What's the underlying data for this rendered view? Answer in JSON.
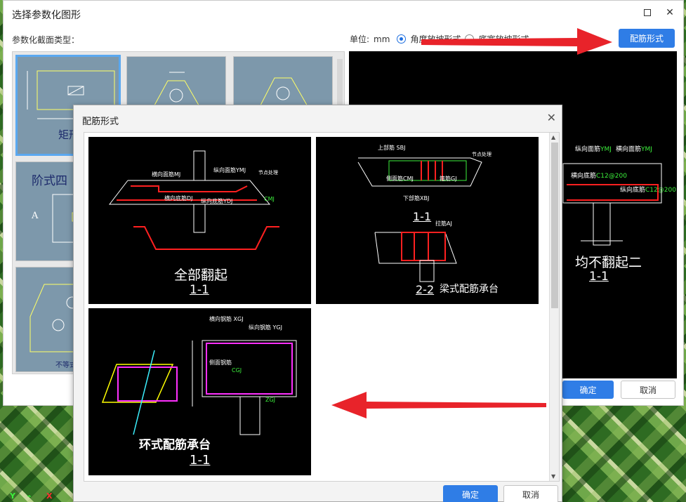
{
  "outer_dialog": {
    "title": "选择参数化图形",
    "section_label": "参数化截面类型：",
    "unit_label": "单位:",
    "unit_value": "mm",
    "radio_angle": "角度放坡形式",
    "radio_width": "底宽放坡形式",
    "rebar_button": "配筋形式",
    "ok": "确定",
    "cancel": "取消",
    "thumb_labels": [
      "矩形",
      "阶式四"
    ],
    "thumb_small": [
      "不等式"
    ],
    "preview_caption": "均不翻起二",
    "preview_section": "1-1"
  },
  "inner_dialog": {
    "title": "配筋形式",
    "ok": "确定",
    "cancel": "取消",
    "cards": [
      {
        "caption": "全部翻起",
        "section": "1-1",
        "labels": [
          "横向面筋MJ",
          "纵向面筋YMJ",
          "横向底筋DJ",
          "纵向底筋YDJ",
          "CMJ",
          "节点处理"
        ]
      },
      {
        "caption": "梁式配筋承台",
        "section1": "1-1",
        "section2": "2-2",
        "labels": [
          "上部筋 SBJ",
          "下部筋XBJ",
          "侧面筋CMJ",
          "节点处理",
          "拉筋AJ",
          "箍筋GJ"
        ]
      },
      {
        "caption": "环式配筋承台",
        "section": "1-1",
        "labels": [
          "横向钢筋 XGJ",
          "纵向钢筋 YGJ",
          "侧面钢筋",
          "CGJ",
          "ZGJ"
        ]
      }
    ]
  },
  "axis": {
    "y": "Y",
    "x": "X"
  },
  "colors": {
    "accent": "#2f7de6",
    "arrow": "#e8232a",
    "rebar_red": "#ff0000"
  }
}
